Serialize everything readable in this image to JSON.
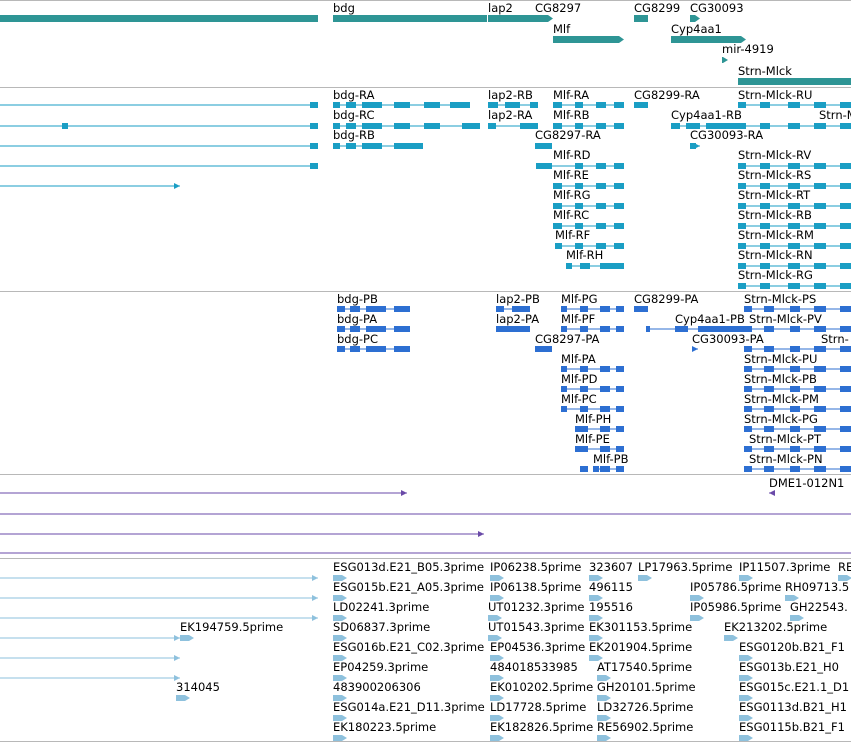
{
  "colors": {
    "gene": "#2e9595",
    "transcript": "#1a9ec4",
    "protein": "#2d6fd2",
    "misc": "#6a4aa8",
    "est": "#8ec1dd",
    "separator": "#b8b8b8"
  },
  "tracks": {
    "genes": {
      "labels": [
        "bdg",
        "lap2",
        "CG8297",
        "CG8299",
        "CG30093",
        "Mlf",
        "Cyp4aa1",
        "mir-4919",
        "Strn-Mlck"
      ]
    },
    "transcripts": {
      "labels": [
        "bdg-RA",
        "bdg-RC",
        "bdg-RB",
        "lap2-RB",
        "lap2-RA",
        "Mlf-RA",
        "Mlf-RB",
        "CG8297-RA",
        "Mlf-RD",
        "Mlf-RE",
        "Mlf-RG",
        "Mlf-RC",
        "Mlf-RF",
        "Mlf-RH",
        "CG8299-RA",
        "Cyp4aa1-RB",
        "CG30093-RA",
        "Strn-Mlck-RU",
        "Strn-M",
        "Strn-Mlck-RV",
        "Strn-Mlck-RS",
        "Strn-Mlck-RT",
        "Strn-Mlck-RB",
        "Strn-Mlck-RM",
        "Strn-Mlck-RN",
        "Strn-Mlck-RG"
      ]
    },
    "proteins": {
      "labels": [
        "bdg-PB",
        "bdg-PA",
        "bdg-PC",
        "lap2-PB",
        "lap2-PA",
        "Mlf-PG",
        "Mlf-PF",
        "CG8297-PA",
        "Mlf-PA",
        "Mlf-PD",
        "Mlf-PC",
        "Mlf-PH",
        "Mlf-PE",
        "Mlf-PB",
        "CG8299-PA",
        "Cyp4aa1-PB",
        "CG30093-PA",
        "Strn-Mlck-PS",
        "Strn-Mlck-PV",
        "Strn-",
        "Strn-Mlck-PU",
        "Strn-Mlck-PB",
        "Strn-Mlck-PM",
        "Strn-Mlck-PG",
        "Strn-Mlck-PT",
        "Strn-Mlck-PN"
      ]
    },
    "misc": {
      "labels": [
        "DME1-012N1"
      ]
    },
    "est": {
      "labels": [
        "ESG013d.E21_B05.3prime",
        "IP06238.5prime",
        "323607",
        "LP17963.5prime",
        "IP11507.3prime",
        "RE",
        "ESG015b.E21_A05.3prime",
        "IP06138.5prime",
        "496115",
        "IP05786.5prime",
        "RH09713.5",
        "LD02241.3prime",
        "UT01232.3prime",
        "195516",
        "IP05986.5prime",
        "GH22543.",
        "EK194759.5prime",
        "SD06837.3prime",
        "UT01543.3prime",
        "EK301153.5prime",
        "EK213202.5prime",
        "ESG016b.E21_C02.3prime",
        "EP04536.3prime",
        "EK201904.5prime",
        "ESG0120b.B21_F1",
        "EP04259.3prime",
        "484018533985",
        "AT17540.5prime",
        "ESG013b.E21_H0",
        "314045",
        "483900206306",
        "EK010202.5prime",
        "GH20101.5prime",
        "ESG015c.E21.1_D1",
        "ESG014a.E21_D11.3prime",
        "LD17728.5prime",
        "LD32726.5prime",
        "ESG0113d.B21_H1",
        "EK180223.5prime",
        "EK182826.5prime",
        "RE56902.5prime",
        "ESG0115b.B21_F1"
      ]
    }
  }
}
